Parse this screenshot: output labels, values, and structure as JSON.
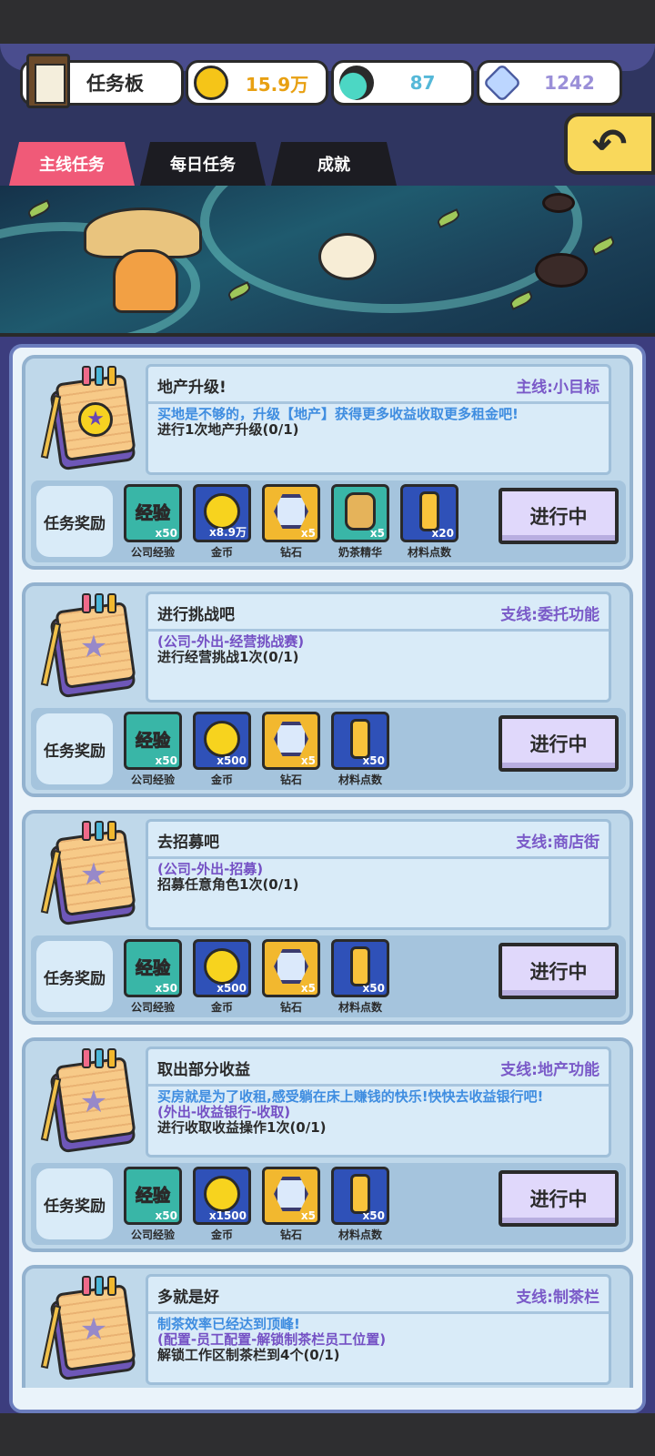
{
  "header": {
    "board_title": "任务板",
    "coins": "15.9万",
    "essence": "87",
    "gems": "1242",
    "back_icon": "back-arrow-icon"
  },
  "tabs": [
    {
      "label": "主线任务",
      "active": true
    },
    {
      "label": "每日任务",
      "active": false
    },
    {
      "label": "成就",
      "active": false
    }
  ],
  "reward_label": "任务奖励",
  "tasks": [
    {
      "title": "地产升级!",
      "tag": "主线:小目标",
      "icon": "medal",
      "lines": [
        {
          "text": "买地是不够的，升级【地产】获得更多收益收取更多租金吧!",
          "color": "blue"
        },
        {
          "text": "进行1次地产升级(0/1)",
          "color": "dark"
        }
      ],
      "rewards": [
        {
          "type": "exp",
          "qty": "x50",
          "name": "公司经验"
        },
        {
          "type": "coin",
          "qty": "x8.9万",
          "name": "金币"
        },
        {
          "type": "gem",
          "qty": "x5",
          "name": "钻石"
        },
        {
          "type": "tea",
          "qty": "x5",
          "name": "奶茶精华"
        },
        {
          "type": "mat",
          "qty": "x20",
          "name": "材料点数"
        }
      ],
      "status": "进行中"
    },
    {
      "title": "进行挑战吧",
      "tag": "支线:委托功能",
      "icon": "star",
      "lines": [
        {
          "text": "(公司-外出-经营挑战赛)",
          "color": "purple"
        },
        {
          "text": "进行经营挑战1次(0/1)",
          "color": "dark"
        }
      ],
      "rewards": [
        {
          "type": "exp",
          "qty": "x50",
          "name": "公司经验"
        },
        {
          "type": "coin",
          "qty": "x500",
          "name": "金币"
        },
        {
          "type": "gem",
          "qty": "x5",
          "name": "钻石"
        },
        {
          "type": "mat",
          "qty": "x50",
          "name": "材料点数"
        }
      ],
      "status": "进行中"
    },
    {
      "title": "去招募吧",
      "tag": "支线:商店街",
      "icon": "star",
      "lines": [
        {
          "text": "(公司-外出-招募)",
          "color": "purple"
        },
        {
          "text": "招募任意角色1次(0/1)",
          "color": "dark"
        }
      ],
      "rewards": [
        {
          "type": "exp",
          "qty": "x50",
          "name": "公司经验"
        },
        {
          "type": "coin",
          "qty": "x500",
          "name": "金币"
        },
        {
          "type": "gem",
          "qty": "x5",
          "name": "钻石"
        },
        {
          "type": "mat",
          "qty": "x50",
          "name": "材料点数"
        }
      ],
      "status": "进行中"
    },
    {
      "title": "取出部分收益",
      "tag": "支线:地产功能",
      "icon": "star",
      "lines": [
        {
          "text": "买房就是为了收租,感受躺在床上赚钱的快乐!快快去收益银行吧!",
          "color": "blue"
        },
        {
          "text": "(外出-收益银行-收取)",
          "color": "purple"
        },
        {
          "text": "进行收取收益操作1次(0/1)",
          "color": "dark"
        }
      ],
      "rewards": [
        {
          "type": "exp",
          "qty": "x50",
          "name": "公司经验"
        },
        {
          "type": "coin",
          "qty": "x1500",
          "name": "金币"
        },
        {
          "type": "gem",
          "qty": "x5",
          "name": "钻石"
        },
        {
          "type": "mat",
          "qty": "x50",
          "name": "材料点数"
        }
      ],
      "status": "进行中"
    },
    {
      "title": "多就是好",
      "tag": "支线:制茶栏",
      "icon": "star",
      "lines": [
        {
          "text": "制茶效率已经达到顶峰!",
          "color": "blue"
        },
        {
          "text": "(配置-员工配置-解锁制茶栏员工位置)",
          "color": "purple"
        },
        {
          "text": "解锁工作区制茶栏到4个(0/1)",
          "color": "dark"
        }
      ],
      "rewards": [
        {
          "type": "exp",
          "qty": "",
          "name": ""
        },
        {
          "type": "gem",
          "qty": "",
          "name": ""
        },
        {
          "type": "mat",
          "qty": "",
          "name": ""
        }
      ],
      "status": ""
    }
  ],
  "colors": {
    "tab_active": "#f05a78",
    "panel_border": "#6b7dbd",
    "accent_blue": "#3f8de0",
    "accent_purple": "#7450c4",
    "back_button": "#f9d85b"
  },
  "exp_glyph_text": "经验"
}
